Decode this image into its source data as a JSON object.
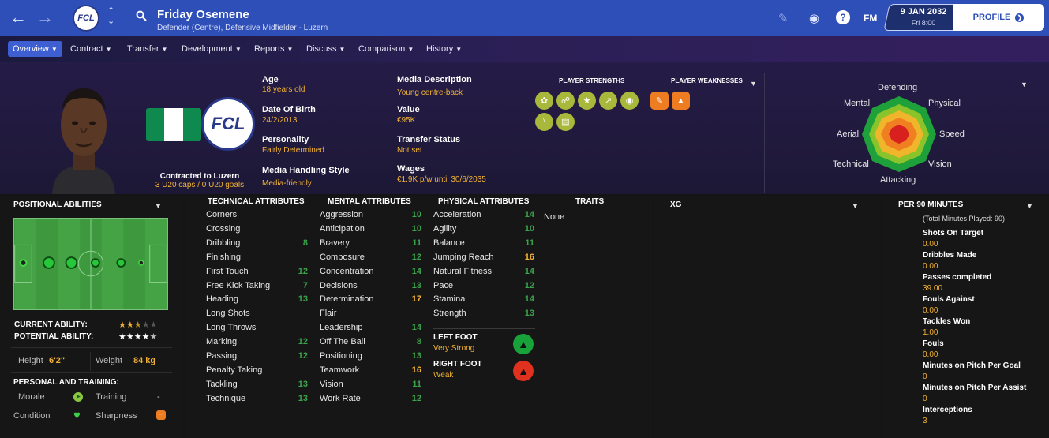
{
  "header": {
    "back_icon": "arrow-left-icon",
    "forward_icon": "arrow-right-icon",
    "club_badge_text": "FCL",
    "player_name": "Friday Osemene",
    "subtitle": "Defender (Centre), Defensive Midfielder - Luzern",
    "date": "9 JAN 2032",
    "time": "Fri 8:00",
    "profile_label": "PROFILE",
    "fm_label": "FM",
    "help_label": "?"
  },
  "nav": {
    "tabs": [
      "Overview",
      "Contract",
      "Transfer",
      "Development",
      "Reports",
      "Discuss",
      "Comparison",
      "History"
    ]
  },
  "bio": {
    "age_label": "Age",
    "age": "18 years old",
    "dob_label": "Date Of Birth",
    "dob": "24/2/2013",
    "personality_label": "Personality",
    "personality": "Fairly Determined",
    "media_style_label": "Media Handling Style",
    "media_style": "Media-friendly",
    "media_desc_label": "Media Description",
    "media_desc": "Young centre-back",
    "value_label": "Value",
    "value": "€95K",
    "transfer_label": "Transfer Status",
    "transfer": "Not set",
    "wages_label": "Wages",
    "wages": "€1.9K p/w until 30/6/2035",
    "contracted": "Contracted to Luzern",
    "caps": "3 U20 caps / 0 U20 goals",
    "club_crest_text": "FCL",
    "nation_flag_colors": [
      "#008751",
      "#ffffff",
      "#008751"
    ]
  },
  "strengths": {
    "strengths_title": "PLAYER STRENGTHS",
    "weaknesses_title": "PLAYER WEAKNESSES",
    "strength_icons": [
      "team-icon",
      "handshake-icon",
      "star-icon",
      "growth-icon",
      "brain-icon",
      "bandage-icon",
      "money-icon"
    ],
    "weakness_icons": [
      "contract-icon",
      "flask-icon"
    ]
  },
  "radar": {
    "labels": {
      "defending": "Defending",
      "physical": "Physical",
      "speed": "Speed",
      "vision": "Vision",
      "attacking": "Attacking",
      "technical": "Technical",
      "aerial": "Aerial",
      "mental": "Mental"
    }
  },
  "positional": {
    "title": "POSITIONAL ABILITIES",
    "current_ability_label": "CURRENT ABILITY:",
    "potential_ability_label": "POTENTIAL ABILITY:",
    "current_ability_stars": 2.5,
    "potential_ability_stars": 4.5,
    "height_label": "Height",
    "height": "6'2\"",
    "weight_label": "Weight",
    "weight": "84 kg",
    "training_title": "PERSONAL AND TRAINING:",
    "morale_label": "Morale",
    "training_label": "Training",
    "training_value": "-",
    "condition_label": "Condition",
    "sharpness_label": "Sharpness"
  },
  "technical": {
    "title": "TECHNICAL ATTRIBUTES",
    "items": [
      {
        "name": "Corners",
        "value": ""
      },
      {
        "name": "Crossing",
        "value": ""
      },
      {
        "name": "Dribbling",
        "value": "8"
      },
      {
        "name": "Finishing",
        "value": ""
      },
      {
        "name": "First Touch",
        "value": "12"
      },
      {
        "name": "Free Kick Taking",
        "value": "7"
      },
      {
        "name": "Heading",
        "value": "13"
      },
      {
        "name": "Long Shots",
        "value": ""
      },
      {
        "name": "Long Throws",
        "value": ""
      },
      {
        "name": "Marking",
        "value": "12"
      },
      {
        "name": "Passing",
        "value": "12"
      },
      {
        "name": "Penalty Taking",
        "value": ""
      },
      {
        "name": "Tackling",
        "value": "13"
      },
      {
        "name": "Technique",
        "value": "13"
      }
    ]
  },
  "mental": {
    "title": "MENTAL ATTRIBUTES",
    "items": [
      {
        "name": "Aggression",
        "value": "10"
      },
      {
        "name": "Anticipation",
        "value": "10"
      },
      {
        "name": "Bravery",
        "value": "11"
      },
      {
        "name": "Composure",
        "value": "12"
      },
      {
        "name": "Concentration",
        "value": "14"
      },
      {
        "name": "Decisions",
        "value": "13"
      },
      {
        "name": "Determination",
        "value": "17"
      },
      {
        "name": "Flair",
        "value": ""
      },
      {
        "name": "Leadership",
        "value": "14"
      },
      {
        "name": "Off The Ball",
        "value": "8"
      },
      {
        "name": "Positioning",
        "value": "13"
      },
      {
        "name": "Teamwork",
        "value": "16"
      },
      {
        "name": "Vision",
        "value": "11"
      },
      {
        "name": "Work Rate",
        "value": "12"
      }
    ]
  },
  "physical": {
    "title": "PHYSICAL ATTRIBUTES",
    "items": [
      {
        "name": "Acceleration",
        "value": "14"
      },
      {
        "name": "Agility",
        "value": "10"
      },
      {
        "name": "Balance",
        "value": "11"
      },
      {
        "name": "Jumping Reach",
        "value": "16"
      },
      {
        "name": "Natural Fitness",
        "value": "14"
      },
      {
        "name": "Pace",
        "value": "12"
      },
      {
        "name": "Stamina",
        "value": "14"
      },
      {
        "name": "Strength",
        "value": "13"
      }
    ],
    "left_foot_label": "LEFT FOOT",
    "left_foot": "Very Strong",
    "right_foot_label": "RIGHT FOOT",
    "right_foot": "Weak"
  },
  "traits": {
    "title": "TRAITS",
    "value": "None"
  },
  "xg": {
    "title": "XG"
  },
  "per90": {
    "title": "PER 90 MINUTES",
    "subtitle": "(Total Minutes Played: 90)",
    "items": [
      {
        "name": "Shots On Target",
        "value": "0.00"
      },
      {
        "name": "Dribbles Made",
        "value": "0.00"
      },
      {
        "name": "Passes completed",
        "value": "39.00"
      },
      {
        "name": "Fouls Against",
        "value": "0.00"
      },
      {
        "name": "Tackles Won",
        "value": "1.00"
      },
      {
        "name": "Fouls",
        "value": "0.00"
      },
      {
        "name": "Minutes on Pitch Per Goal",
        "value": "0"
      },
      {
        "name": "Minutes on Pitch Per Assist",
        "value": "0"
      },
      {
        "name": "Interceptions",
        "value": "3"
      }
    ]
  },
  "colors": {
    "header_blue": "#2e4fb8",
    "accent_yellow": "#f2b233",
    "attr_green": "#3aa34a"
  }
}
